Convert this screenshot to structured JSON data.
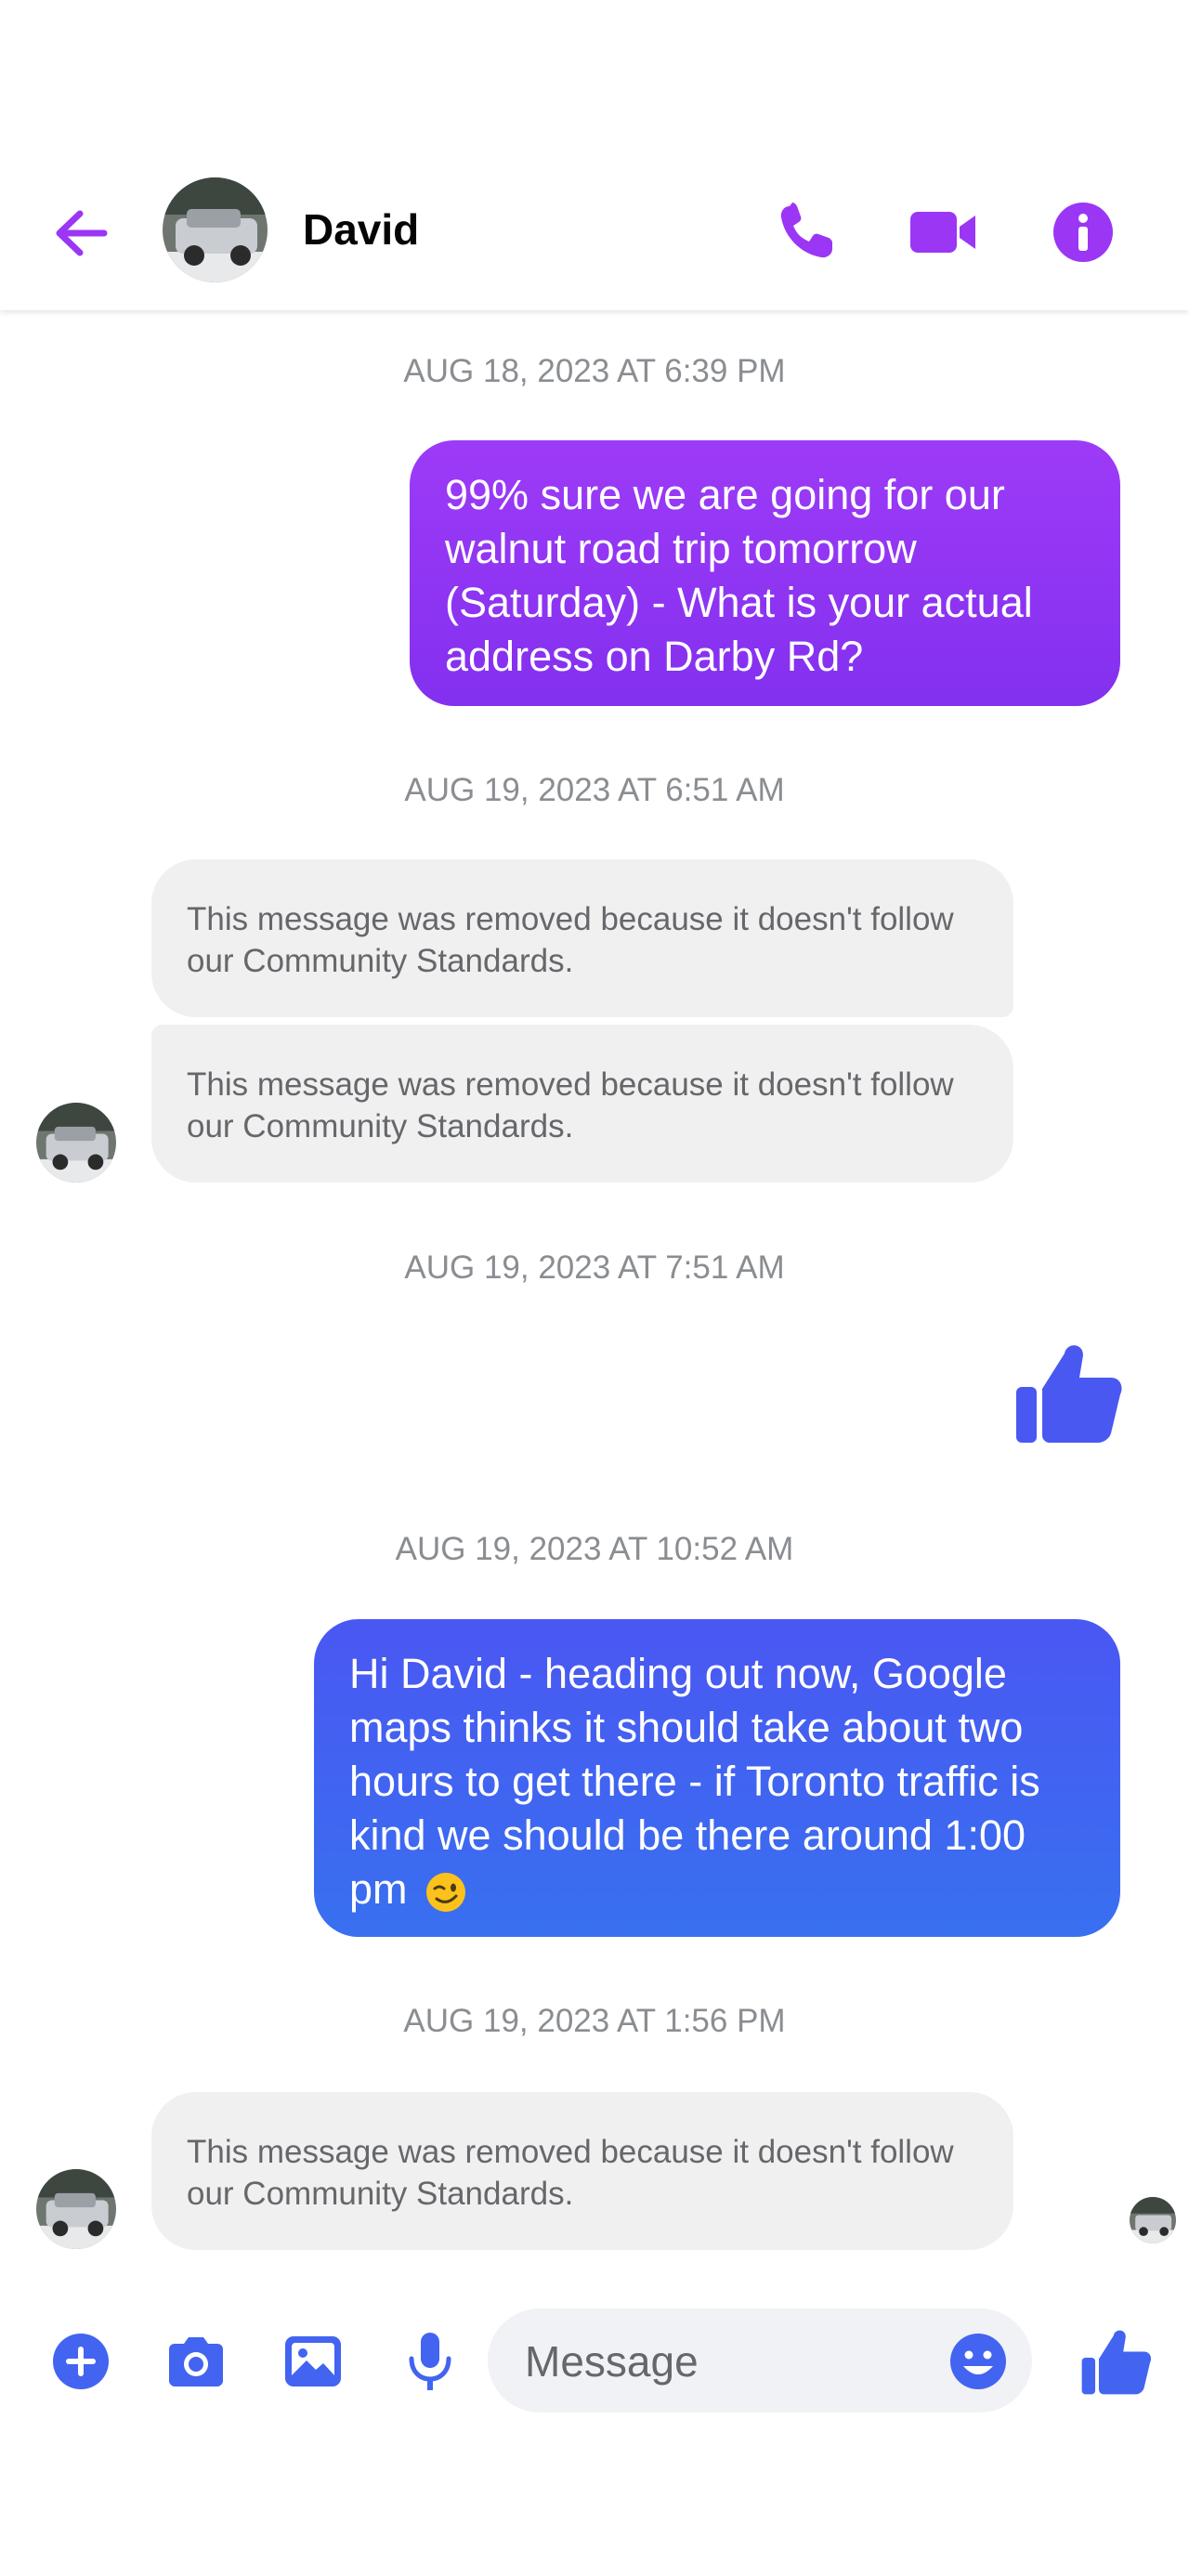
{
  "header": {
    "contact_name": "David",
    "back_icon": "arrow-left-icon",
    "actions": [
      "phone-icon",
      "video-camera-icon",
      "info-icon"
    ]
  },
  "colors": {
    "accent_purple": "#9b36f5",
    "accent_blue": "#4264f0",
    "bubble_gray": "#f0f0f0",
    "timestamp_gray": "#8a8d91"
  },
  "messages": [
    {
      "timestamp": "AUG 18, 2023 AT 6:39 PM"
    },
    {
      "direction": "outgoing",
      "text": "99% sure we are going for our walnut road trip tomorrow (Saturday) - What is your actual address on Darby Rd?"
    },
    {
      "timestamp": "AUG 19, 2023 AT 6:51 AM"
    },
    {
      "direction": "incoming",
      "text": "This message was removed because it doesn't follow our Community Standards."
    },
    {
      "direction": "incoming",
      "text": "This message was removed because it doesn't follow our Community Standards."
    },
    {
      "timestamp": "AUG 19, 2023 AT 7:51 AM"
    },
    {
      "direction": "outgoing",
      "sticker": "thumbs-up-icon"
    },
    {
      "timestamp": "AUG 19, 2023 AT 10:52 AM"
    },
    {
      "direction": "outgoing",
      "text": "Hi David - heading out now, Google maps thinks it should take about two hours to get there - if Toronto traffic is kind we should be there around 1:00 pm",
      "emoji": "winking-face-icon"
    },
    {
      "timestamp": "AUG 19, 2023 AT 1:56 PM"
    },
    {
      "direction": "incoming",
      "text": "This message was removed because it doesn't follow our Community Standards."
    }
  ],
  "composer": {
    "placeholder": "Message",
    "icons": [
      "plus-icon",
      "camera-icon",
      "gallery-icon",
      "microphone-icon",
      "emoji-icon",
      "thumbs-up-icon"
    ]
  }
}
